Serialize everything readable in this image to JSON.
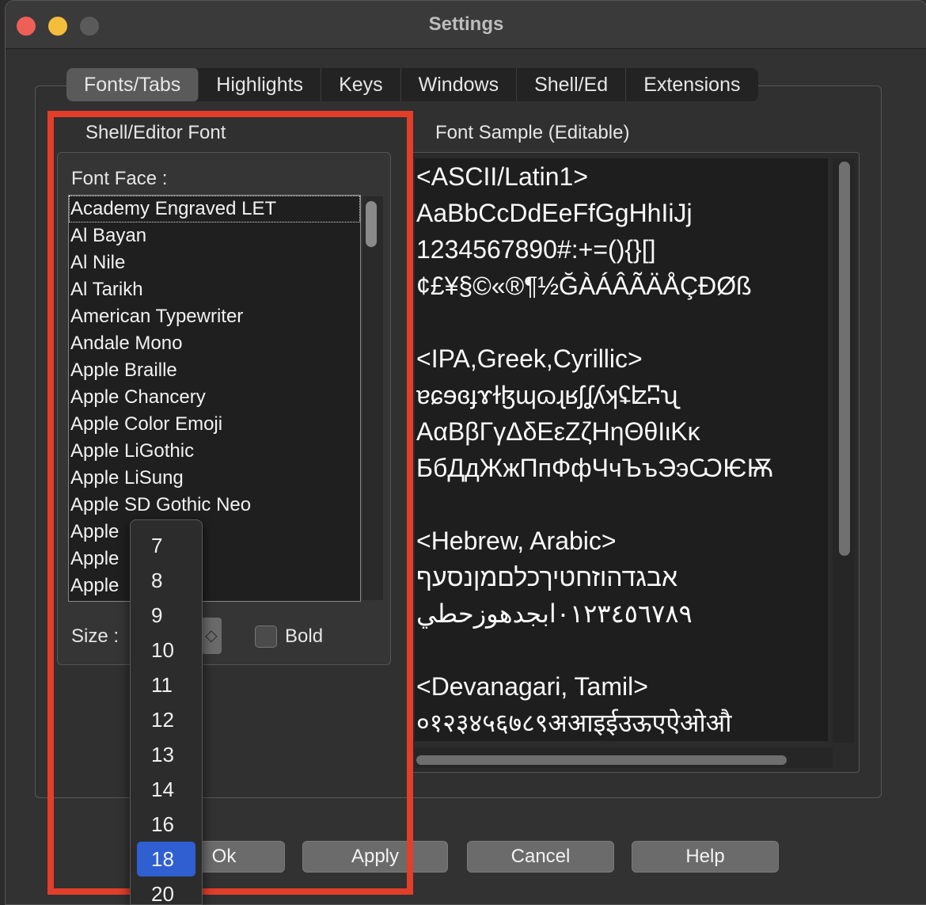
{
  "window": {
    "title": "Settings"
  },
  "tabs": [
    "Fonts/Tabs",
    "Highlights",
    "Keys",
    "Windows",
    "Shell/Ed",
    "Extensions"
  ],
  "font_group": {
    "label": "Shell/Editor Font",
    "face_label": "Font Face :",
    "fonts": [
      "Academy Engraved LET",
      "Al Bayan",
      "Al Nile",
      "Al Tarikh",
      "American Typewriter",
      "Andale Mono",
      "Apple Braille",
      "Apple Chancery",
      "Apple Color Emoji",
      "Apple LiGothic",
      "Apple LiSung",
      "Apple SD Gothic Neo",
      "Apple",
      "Apple",
      "Apple"
    ],
    "selected_font": "Academy Engraved LET",
    "size_label": "Size :",
    "bold_label": "Bold"
  },
  "size_dropdown": {
    "options": [
      "7",
      "8",
      "9",
      "10",
      "11",
      "12",
      "13",
      "14",
      "16",
      "18",
      "20"
    ],
    "selected": "18"
  },
  "sample": {
    "label": "Font Sample (Editable)",
    "text": "<ASCII/Latin1>\nAaBbCcDdEeFfGgHhIiJj\n1234567890#:+=(){}[]\n¢£¥§©«®¶½ĞÀÁÂÃÄÅÇÐØß\n\n<IPA,Greek,Cyrillic>\nɐɕɘɞɟɤɫɮɰɷɻʁʃʆʎʞʢʫʭʯ\nΑαΒβΓγΔδΕεΖζΗηΘθΙιΚκ\nБбДдЖжПпФфЧчЪъЭэѠѤѬ\n\n<Hebrew, Arabic>\nאבגדהוזחטיךכלםמןנסעף\n٠١٢٣٤٥٦٧٨٩ابجدهوزحطي\n\n<Devanagari, Tamil>\n०१२३४५६७८९अआइईउऊएऐओऔ"
  },
  "buttons": {
    "ok": "Ok",
    "apply": "Apply",
    "cancel": "Cancel",
    "help": "Help"
  },
  "colors": {
    "highlight": "#e23e2a",
    "selection": "#2f5fd0"
  }
}
